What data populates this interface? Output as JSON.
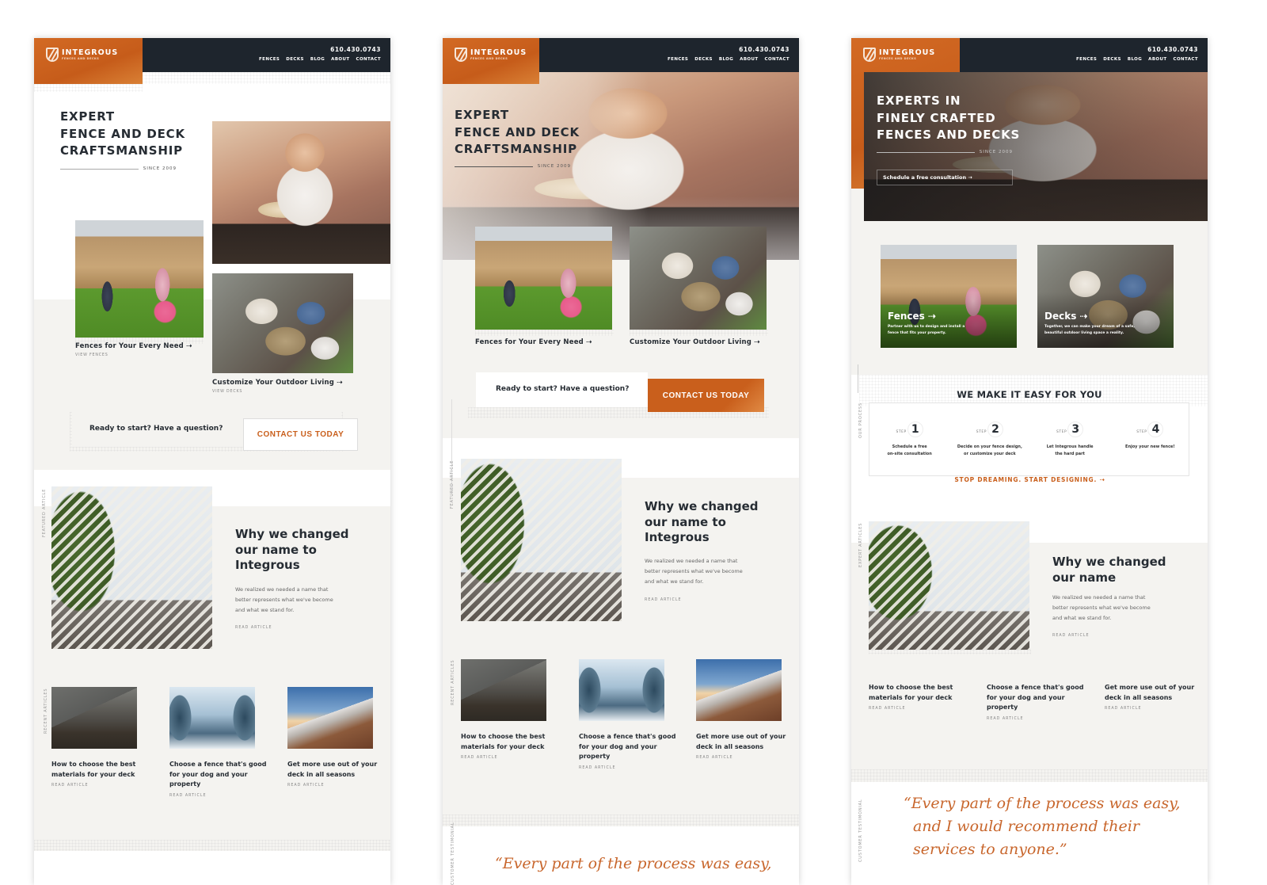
{
  "brand": {
    "name": "INTEGROUS",
    "tagline": "FENCES AND DECKS",
    "phone": "610.430.0743",
    "accent_color": "#c95f1c",
    "dark_color": "#1e252d",
    "nav": [
      "FENCES",
      "DECKS",
      "BLOG",
      "ABOUT",
      "CONTACT"
    ]
  },
  "mockups": [
    {
      "hero": {
        "title_lines": [
          "EXPERT",
          "FENCE AND DECK",
          "CRAFTSMANSHIP"
        ],
        "since": "SINCE 2009"
      },
      "cards": [
        {
          "title": "Fences for Your Every Need ⇢",
          "sub": "VIEW FENCES"
        },
        {
          "title": "Customize Your Outdoor Living ⇢",
          "sub": "VIEW DECKS"
        }
      ],
      "cta": {
        "question": "Ready to start? Have a question?",
        "button": "CONTACT US TODAY"
      },
      "featured": {
        "label": "FEATURED ARTICLE",
        "title_lines": [
          "Why we changed",
          "our name to",
          "Integrous"
        ],
        "body_lines": [
          "We realized we needed a name that",
          "better represents what we've become",
          "and what we stand for."
        ],
        "read": "READ ARTICLE"
      },
      "recent": {
        "label": "RECENT ARTICLES",
        "items": [
          {
            "title_lines": [
              "How to choose the best",
              "materials for your deck"
            ],
            "read": "READ ARTICLE"
          },
          {
            "title_lines": [
              "Choose a fence that's good",
              "for your dog and your",
              "property"
            ],
            "read": "READ ARTICLE"
          },
          {
            "title_lines": [
              "Get more use out of your",
              "deck in all seasons"
            ],
            "read": "READ ARTICLE"
          }
        ]
      }
    },
    {
      "hero": {
        "title_lines": [
          "EXPERT",
          "FENCE AND DECK",
          "CRAFTSMANSHIP"
        ],
        "since": "SINCE 2009"
      },
      "cards": [
        {
          "title": "Fences for Your Every Need ⇢"
        },
        {
          "title": "Customize Your Outdoor Living ⇢"
        }
      ],
      "cta": {
        "question": "Ready to start? Have a question?",
        "button": "CONTACT US TODAY"
      },
      "featured": {
        "label": "FEATURED ARTICLE",
        "title_lines": [
          "Why we changed",
          "our name to",
          "Integrous"
        ],
        "body_lines": [
          "We realized we needed a name that",
          "better represents what we've become",
          "and what we stand for."
        ],
        "read": "READ ARTICLE"
      },
      "recent": {
        "label": "RECENT ARTICLES",
        "items": [
          {
            "title_lines": [
              "How to choose the best",
              "materials for your deck"
            ],
            "read": "READ ARTICLE"
          },
          {
            "title_lines": [
              "Choose a fence that's good",
              "for your dog and your",
              "property"
            ],
            "read": "READ ARTICLE"
          },
          {
            "title_lines": [
              "Get more use out of your",
              "deck in all seasons"
            ],
            "read": "READ ARTICLE"
          }
        ]
      },
      "testimonial": {
        "label": "CUSTOMER TESTIMONIAL",
        "quote_partial": "“Every part of the process was easy,"
      }
    },
    {
      "hero": {
        "title_lines": [
          "EXPERTS IN",
          "FINELY CRAFTED",
          "FENCES AND DECKS"
        ],
        "since": "SINCE 2009",
        "button": "Schedule a free consultation ⇢"
      },
      "cards": [
        {
          "title": "Fences ⇢",
          "desc_lines": [
            "Partner with us to design and install a",
            "fence that fits your property."
          ]
        },
        {
          "title": "Decks ⇢",
          "desc_lines": [
            "Together, we can make your dream of a safe,",
            "beautiful outdoor living space a reality."
          ]
        }
      ],
      "process": {
        "label": "OUR PROCESS",
        "title": "WE MAKE IT EASY FOR YOU",
        "step_label": "STEP",
        "steps": [
          {
            "num": "1",
            "desc_lines": [
              "Schedule a free",
              "on-site consultation"
            ]
          },
          {
            "num": "2",
            "desc_lines": [
              "Decide on your fence design,",
              "or customize your deck"
            ]
          },
          {
            "num": "3",
            "desc_lines": [
              "Let Integrous handle",
              "the hard part"
            ]
          },
          {
            "num": "4",
            "desc_lines": [
              "Enjoy your new fence!"
            ]
          }
        ],
        "link": "STOP DREAMING. START DESIGNING. ⇢"
      },
      "featured": {
        "label": "EXPERT ARTICLES",
        "title_lines": [
          "Why we changed",
          "our name"
        ],
        "body_lines": [
          "We realized we needed a name that",
          "better represents what we've become",
          "and what we stand for."
        ],
        "read": "READ ARTICLE"
      },
      "recent": {
        "items": [
          {
            "title_lines": [
              "How to choose the best",
              "materials for your deck"
            ],
            "read": "READ ARTICLE"
          },
          {
            "title_lines": [
              "Choose a fence that's good",
              "for your dog and your",
              "property"
            ],
            "read": "READ ARTICLE"
          },
          {
            "title_lines": [
              "Get more use out of your",
              "deck in all seasons"
            ],
            "read": "READ ARTICLE"
          }
        ]
      },
      "testimonial": {
        "label": "CUSTOMER TESTIMONIAL",
        "quote_lines": [
          "“Every part of the process was easy,",
          "and I would recommend their",
          "services to anyone.”"
        ]
      }
    }
  ]
}
